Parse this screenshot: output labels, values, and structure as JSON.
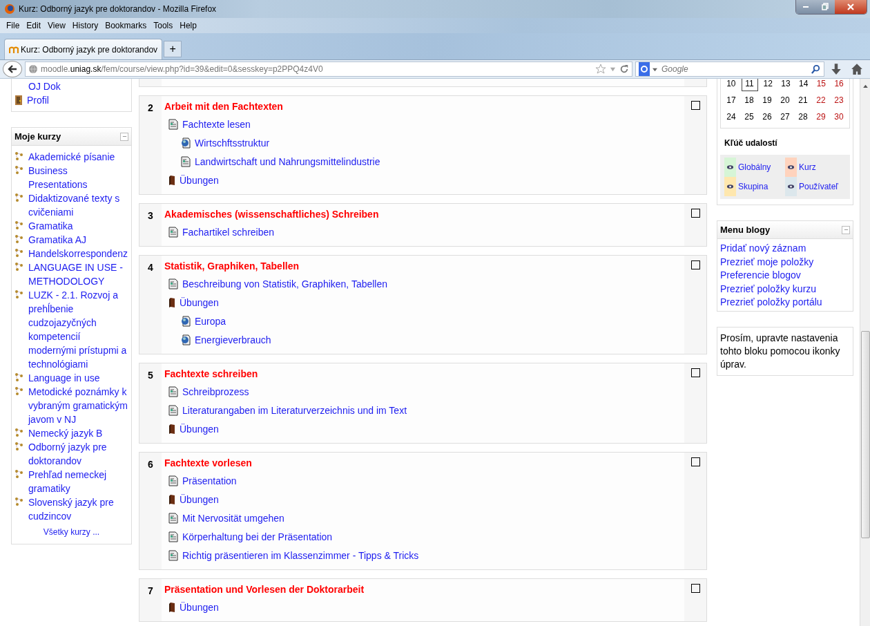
{
  "window": {
    "title": "Kurz: Odborný jazyk pre doktorandov - Mozilla Firefox"
  },
  "menu_bar": [
    "File",
    "Edit",
    "View",
    "History",
    "Bookmarks",
    "Tools",
    "Help"
  ],
  "tabs": [
    {
      "label": "Kurz: Odborný jazyk pre doktorandov",
      "selected": true
    }
  ],
  "new_tab": "+",
  "address_bar": {
    "prefix": "moodle.",
    "domain": "uniag.sk",
    "path": "/fem/course/view.php?id=39&edit=0&sesskey=p2PPQ4z4V0"
  },
  "search": {
    "placeholder": "Google"
  },
  "left_top_block": {
    "items": [
      {
        "label": "OJ Dok",
        "kind": "none"
      },
      {
        "label": "Profil",
        "kind": "profile"
      }
    ]
  },
  "courses_block": {
    "title": "Moje kurzy",
    "items": [
      "Akademické písanie",
      "Business Presentations",
      "Didaktizované texty s cvičeniami",
      "Gramatika",
      "Gramatika AJ",
      "Handelskorrespondenz",
      "LANGUAGE IN USE - METHODOLOGY",
      "LUZK - 2.1. Rozvoj a prehĺbenie cudzojazyčných kompetencií modernými prístupmi a technológiami",
      "Language in use",
      "Metodické poznámky k vybraným gramatickým javom v NJ",
      "Nemecký jazyk B",
      "Odborný jazyk pre doktorandov",
      "Prehľad nemeckej gramatiky",
      "Slovenský jazyk pre cudzincov"
    ],
    "all_link": "Všetky kurzy ..."
  },
  "sections": [
    {
      "number": "2",
      "highlighted": false,
      "title": "Arbeit mit den Fachtexten",
      "items": [
        {
          "label": "Fachtexte lesen",
          "kind": "page",
          "children": [
            {
              "label": "Wirtschftsstruktur",
              "kind": "url"
            },
            {
              "label": "Landwirtschaft und Nahrungsmittelindustrie",
              "kind": "page"
            }
          ]
        },
        {
          "label": "Übungen",
          "kind": "book"
        }
      ]
    },
    {
      "number": "3",
      "highlighted": false,
      "title": "Akademisches (wissenschaftliches) Schreiben",
      "items": [
        {
          "label": "Fachartikel schreiben",
          "kind": "page"
        }
      ]
    },
    {
      "number": "4",
      "highlighted": false,
      "title": "Statistik, Graphiken, Tabellen",
      "items": [
        {
          "label": "Beschreibung von Statistik, Graphiken, Tabellen",
          "kind": "page"
        },
        {
          "label": "Übungen",
          "kind": "book",
          "children": [
            {
              "label": "Europa",
              "kind": "url"
            },
            {
              "label": "Energieverbrauch",
              "kind": "url"
            }
          ]
        }
      ]
    },
    {
      "number": "5",
      "highlighted": false,
      "title": "Fachtexte schreiben",
      "items": [
        {
          "label": "Schreibprozess",
          "kind": "page"
        },
        {
          "label": "Literaturangaben im Literaturverzeichnis und im Text",
          "kind": "page"
        },
        {
          "label": "Übungen",
          "kind": "book"
        }
      ]
    },
    {
      "number": "6",
      "highlighted": false,
      "title": "Fachtexte vorlesen",
      "items": [
        {
          "label": "Präsentation",
          "kind": "page"
        },
        {
          "label": "Übungen",
          "kind": "book"
        },
        {
          "label": "Mit Nervosität umgehen",
          "kind": "page"
        },
        {
          "label": "Körperhaltung bei der Präsentation",
          "kind": "page"
        },
        {
          "label": "Richtig präsentieren im Klassenzimmer - Tipps & Tricks",
          "kind": "page"
        }
      ]
    },
    {
      "number": "7",
      "highlighted": false,
      "title": "Präsentation und Vorlesen der Doktorarbeit",
      "items": [
        {
          "label": "Übungen",
          "kind": "book"
        }
      ]
    }
  ],
  "calendar": {
    "weeks": [
      [
        {
          "day": "10",
          "weekend": false,
          "today": false
        },
        {
          "day": "11",
          "weekend": false,
          "today": true
        },
        {
          "day": "12",
          "weekend": false,
          "today": false
        },
        {
          "day": "13",
          "weekend": false,
          "today": false
        },
        {
          "day": "14",
          "weekend": false,
          "today": false
        },
        {
          "day": "15",
          "weekend": true,
          "today": false
        },
        {
          "day": "16",
          "weekend": true,
          "today": false
        }
      ],
      [
        {
          "day": "17",
          "weekend": false,
          "today": false
        },
        {
          "day": "18",
          "weekend": false,
          "today": false
        },
        {
          "day": "19",
          "weekend": false,
          "today": false
        },
        {
          "day": "20",
          "weekend": false,
          "today": false
        },
        {
          "day": "21",
          "weekend": false,
          "today": false
        },
        {
          "day": "22",
          "weekend": true,
          "today": false
        },
        {
          "day": "23",
          "weekend": true,
          "today": false
        }
      ],
      [
        {
          "day": "24",
          "weekend": false,
          "today": false
        },
        {
          "day": "25",
          "weekend": false,
          "today": false
        },
        {
          "day": "26",
          "weekend": false,
          "today": false
        },
        {
          "day": "27",
          "weekend": false,
          "today": false
        },
        {
          "day": "28",
          "weekend": false,
          "today": false
        },
        {
          "day": "29",
          "weekend": true,
          "today": false
        },
        {
          "day": "30",
          "weekend": true,
          "today": false
        }
      ]
    ],
    "legend_title": "Kľúč udalostí",
    "legend": [
      {
        "label": "Globálny",
        "color": "#d6f5d6"
      },
      {
        "label": "Kurz",
        "color": "#ffd3bd"
      },
      {
        "label": "Skupina",
        "color": "#fee7ae"
      },
      {
        "label": "Používateľ",
        "color": "#dce7ec"
      }
    ]
  },
  "blog_menu": {
    "title": "Menu blogy",
    "items": [
      "Pridať nový záznam",
      "Prezrieť moje položky",
      "Preferencie blogov",
      "Prezrieť položky kurzu",
      "Prezrieť položky portálu"
    ]
  },
  "info_block": {
    "text": "Prosím, upravte nastavenia tohto bloku pomocou ikonky úprav."
  }
}
